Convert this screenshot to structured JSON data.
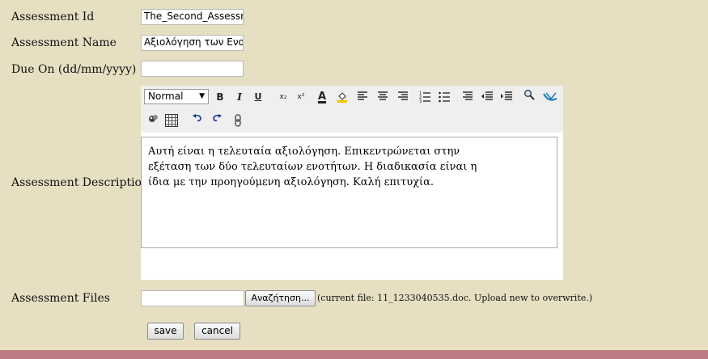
{
  "form": {
    "assessment_id": {
      "label": "Assessment Id",
      "value": "The_Second_Assessn"
    },
    "assessment_name": {
      "label": "Assessment Name",
      "value": "Αξιολόγηση των Ενοτή"
    },
    "due_on": {
      "label": "Due On (dd/mm/yyyy)",
      "value": ""
    },
    "description": {
      "label": "Assessment Description",
      "text": "Αυτή είναι η τελευταία αξιολόγηση. Επικεντρώνεται στην εξέταση των δύο τελευταίων ενοτήτων. Η διαδικασία είναι η ίδια με την προηγούμενη αξιολόγηση. Καλή επιτυχία."
    },
    "files": {
      "label": "Assessment Files",
      "browse_label": "Αναζήτηση...",
      "current_file_note": "(current file: 11_1233040535.doc. Upload new to overwrite.)"
    }
  },
  "editor_toolbar": {
    "format_value": "Normal",
    "bold_label": "B",
    "italic_label": "I",
    "underline_label": "U",
    "subscript_label": "x₂",
    "superscript_label": "x²",
    "font_color_label": "A"
  },
  "actions": {
    "save_label": "save",
    "cancel_label": "cancel"
  },
  "colors": {
    "background": "#e6dfc2",
    "footer": "#bb7b83",
    "toolbar": "#efefef"
  }
}
